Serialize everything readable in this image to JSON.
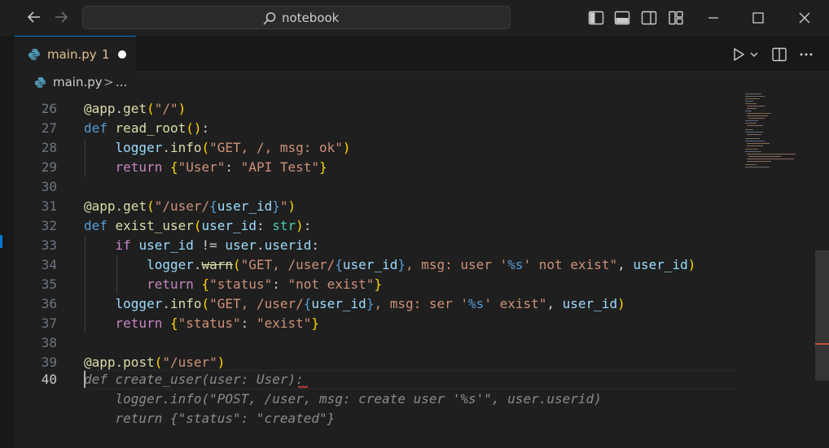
{
  "titlebar": {
    "search_text": "notebook"
  },
  "tab": {
    "filename": "main.py",
    "problem_count": "1"
  },
  "breadcrumb": {
    "file": "main.py",
    "separator": ">",
    "more": "..."
  },
  "editor": {
    "line_numbers": [
      "26",
      "27",
      "28",
      "29",
      "30",
      "31",
      "32",
      "33",
      "34",
      "35",
      "36",
      "37",
      "38",
      "39",
      "40"
    ],
    "active_line": "40",
    "ghost_suggestion": [
      "def create_user(user: User):",
      "    logger.info(\"POST, /user, msg: create user '%s'\", user.userid)",
      "    return {\"status\": \"created\"}"
    ]
  },
  "colors": {
    "accent": "#0078d4",
    "modified_tab": "#e2c08d",
    "error": "#f14c4c"
  },
  "icons": [
    "arrow-left-icon",
    "arrow-right-icon",
    "search-icon",
    "toggle-primary-sidebar-icon",
    "toggle-panel-icon",
    "toggle-secondary-sidebar-icon",
    "customize-layout-icon",
    "minimize-icon",
    "maximize-icon",
    "close-icon",
    "python-file-icon",
    "run-icon",
    "split-editor-icon",
    "more-actions-icon"
  ]
}
